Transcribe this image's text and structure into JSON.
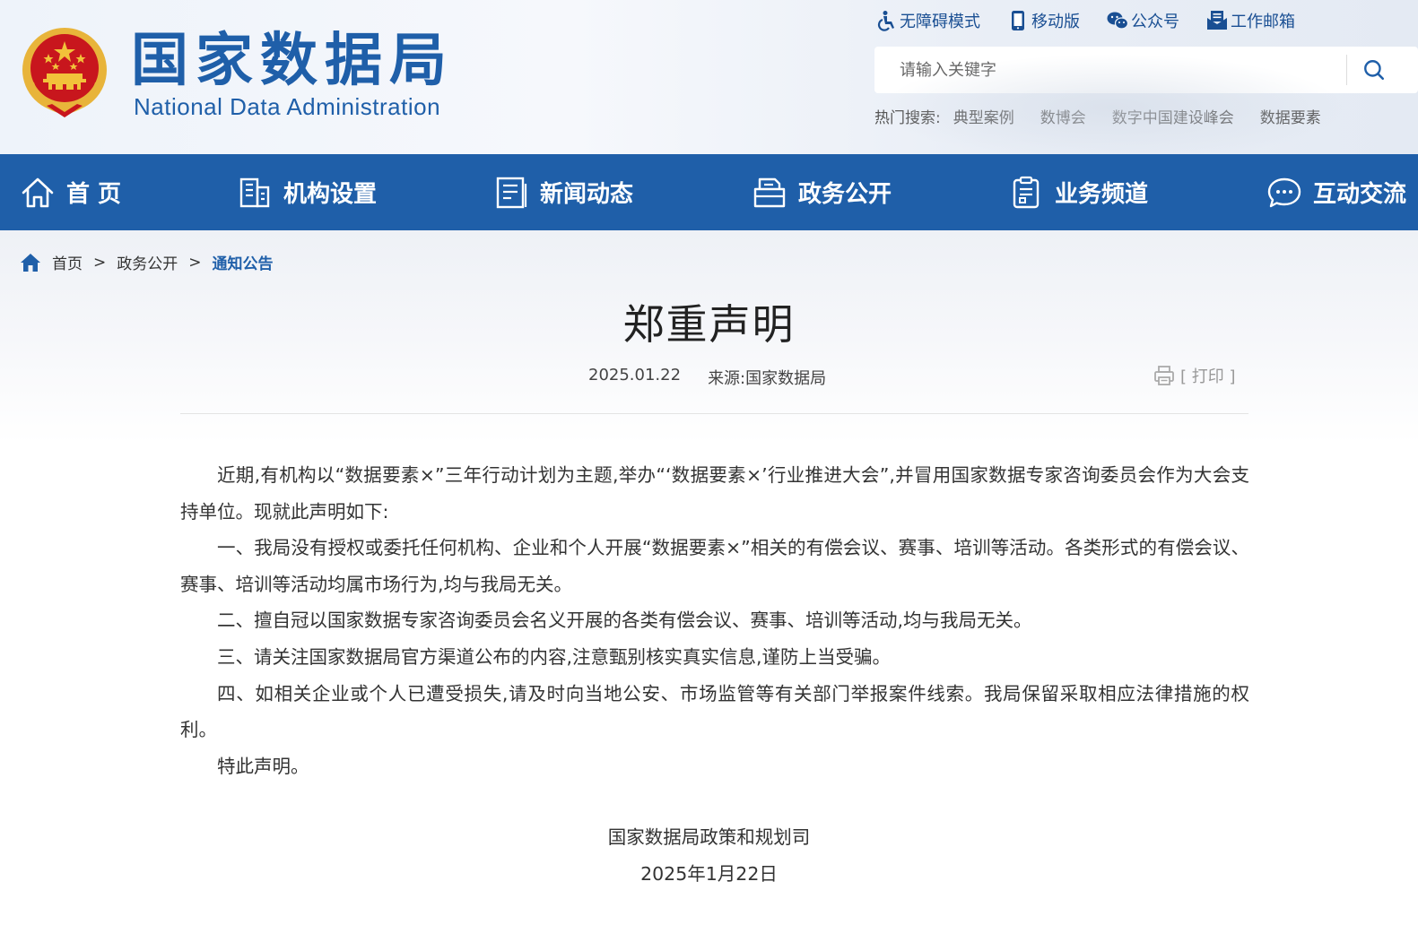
{
  "header": {
    "logo_cn": "国家数据局",
    "logo_en": "National Data Administration",
    "toplinks": [
      {
        "label": "无障碍模式",
        "icon": "accessibility-icon"
      },
      {
        "label": "移动版",
        "icon": "mobile-icon"
      },
      {
        "label": "公众号",
        "icon": "wechat-icon"
      },
      {
        "label": "工作邮箱",
        "icon": "mail-icon"
      }
    ],
    "search": {
      "placeholder": "请输入关键字"
    },
    "hot": {
      "label": "热门搜索:",
      "items": [
        "典型案例",
        "数博会",
        "数字中国建设峰会",
        "数据要素"
      ]
    }
  },
  "nav": {
    "items": [
      {
        "label": "首 页",
        "icon": "home-icon"
      },
      {
        "label": "机构设置",
        "icon": "building-icon"
      },
      {
        "label": "新闻动态",
        "icon": "news-icon"
      },
      {
        "label": "政务公开",
        "icon": "folder-icon"
      },
      {
        "label": "业务频道",
        "icon": "clipboard-icon"
      },
      {
        "label": "互动交流",
        "icon": "chat-icon"
      }
    ]
  },
  "breadcrumb": {
    "items": [
      "首页",
      "政务公开",
      "通知公告"
    ],
    "separator": ">"
  },
  "article": {
    "title": "郑重声明",
    "date": "2025.01.22",
    "source": "来源:国家数据局",
    "print_label": "[ 打印 ]",
    "paragraphs": [
      "近期,有机构以“数据要素×”三年行动计划为主题,举办“‘数据要素×’行业推进大会”,并冒用国家数据专家咨询委员会作为大会支持单位。现就此声明如下:",
      "一、我局没有授权或委托任何机构、企业和个人开展“数据要素×”相关的有偿会议、赛事、培训等活动。各类形式的有偿会议、赛事、培训等活动均属市场行为,均与我局无关。",
      "二、擅自冠以国家数据专家咨询委员会名义开展的各类有偿会议、赛事、培训等活动,均与我局无关。",
      "三、请关注国家数据局官方渠道公布的内容,注意甄别核实真实信息,谨防上当受骗。",
      "四、如相关企业或个人已遭受损失,请及时向当地公安、市场监管等有关部门举报案件线索。我局保留采取相应法律措施的权利。",
      "特此声明。"
    ],
    "signature": {
      "org": "国家数据局政策和规划司",
      "date": "2025年1月22日"
    }
  },
  "colors": {
    "brand_blue": "#1f5fa9",
    "emblem_red": "#c8161d",
    "emblem_gold": "#f2b630"
  }
}
